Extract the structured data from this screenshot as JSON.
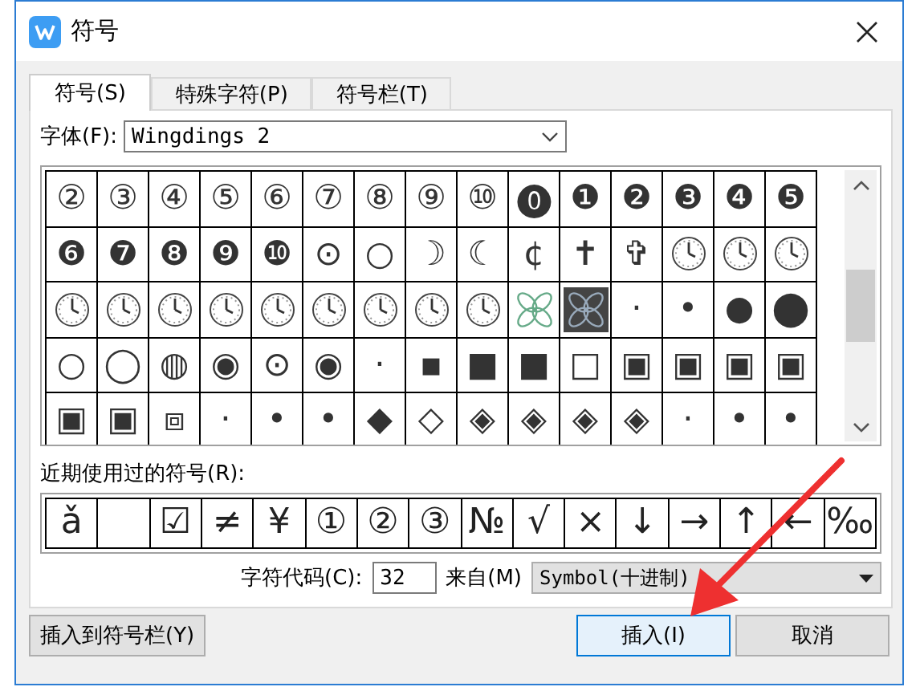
{
  "window": {
    "title": "符号"
  },
  "tabs": [
    {
      "label": "符号(S)",
      "selected": true
    },
    {
      "label": "特殊字符(P)",
      "selected": false
    },
    {
      "label": "符号栏(T)",
      "selected": false
    }
  ],
  "font": {
    "label": "字体(F):",
    "value": "Wingdings 2"
  },
  "symbol_grid": [
    [
      {
        "kind": "glyph",
        "symbol": "②"
      },
      {
        "kind": "glyph",
        "symbol": "③"
      },
      {
        "kind": "glyph",
        "symbol": "④"
      },
      {
        "kind": "glyph",
        "symbol": "⑤"
      },
      {
        "kind": "glyph",
        "symbol": "⑥"
      },
      {
        "kind": "glyph",
        "symbol": "⑦"
      },
      {
        "kind": "glyph",
        "symbol": "⑧"
      },
      {
        "kind": "glyph",
        "symbol": "⑨"
      },
      {
        "kind": "glyph",
        "symbol": "⑩"
      },
      {
        "kind": "glyph",
        "symbol": "⓿"
      },
      {
        "kind": "glyph",
        "symbol": "❶"
      },
      {
        "kind": "glyph",
        "symbol": "❷"
      },
      {
        "kind": "glyph",
        "symbol": "❸"
      },
      {
        "kind": "glyph",
        "symbol": "❹"
      },
      {
        "kind": "glyph",
        "symbol": "❺"
      }
    ],
    [
      {
        "kind": "glyph",
        "symbol": "❻"
      },
      {
        "kind": "glyph",
        "symbol": "❼"
      },
      {
        "kind": "glyph",
        "symbol": "❽"
      },
      {
        "kind": "glyph",
        "symbol": "❾"
      },
      {
        "kind": "glyph",
        "symbol": "❿"
      },
      {
        "kind": "glyph",
        "symbol": "⊙"
      },
      {
        "kind": "glyph",
        "symbol": "○"
      },
      {
        "kind": "glyph",
        "symbol": "☽"
      },
      {
        "kind": "glyph",
        "symbol": "☾"
      },
      {
        "kind": "glyph",
        "symbol": "¢"
      },
      {
        "kind": "glyph",
        "symbol": "✝"
      },
      {
        "kind": "glyph",
        "symbol": "✞"
      },
      {
        "kind": "clock"
      },
      {
        "kind": "clock"
      },
      {
        "kind": "clock"
      }
    ],
    [
      {
        "kind": "clock"
      },
      {
        "kind": "clock"
      },
      {
        "kind": "clock"
      },
      {
        "kind": "clock"
      },
      {
        "kind": "clock"
      },
      {
        "kind": "clock"
      },
      {
        "kind": "clock"
      },
      {
        "kind": "clock"
      },
      {
        "kind": "clock"
      },
      {
        "kind": "petals",
        "filled": false
      },
      {
        "kind": "petals",
        "filled": true
      },
      {
        "kind": "glyph",
        "symbol": "·"
      },
      {
        "kind": "glyph",
        "symbol": "•"
      },
      {
        "kind": "glyph",
        "symbol": "●"
      },
      {
        "kind": "glyph",
        "symbol": "⬤"
      }
    ],
    [
      {
        "kind": "glyph",
        "symbol": "○"
      },
      {
        "kind": "glyph",
        "symbol": "◯"
      },
      {
        "kind": "glyph",
        "symbol": "◍"
      },
      {
        "kind": "glyph",
        "symbol": "◉"
      },
      {
        "kind": "glyph",
        "symbol": "⊙"
      },
      {
        "kind": "glyph",
        "symbol": "◉"
      },
      {
        "kind": "glyph",
        "symbol": "·"
      },
      {
        "kind": "glyph",
        "symbol": "▪"
      },
      {
        "kind": "glyph",
        "symbol": "■"
      },
      {
        "kind": "glyph",
        "symbol": "■"
      },
      {
        "kind": "glyph",
        "symbol": "□"
      },
      {
        "kind": "glyph",
        "symbol": "▣"
      },
      {
        "kind": "glyph",
        "symbol": "▣"
      },
      {
        "kind": "glyph",
        "symbol": "▣"
      },
      {
        "kind": "glyph",
        "symbol": "▣"
      }
    ],
    [
      {
        "kind": "glyph",
        "symbol": "▣"
      },
      {
        "kind": "glyph",
        "symbol": "▣"
      },
      {
        "kind": "glyph",
        "symbol": "⧈"
      },
      {
        "kind": "glyph",
        "symbol": "·"
      },
      {
        "kind": "glyph",
        "symbol": "•"
      },
      {
        "kind": "glyph",
        "symbol": "•"
      },
      {
        "kind": "glyph",
        "symbol": "◆"
      },
      {
        "kind": "glyph",
        "symbol": "◇"
      },
      {
        "kind": "glyph",
        "symbol": "◈"
      },
      {
        "kind": "glyph",
        "symbol": "◈"
      },
      {
        "kind": "glyph",
        "symbol": "◈"
      },
      {
        "kind": "glyph",
        "symbol": "◈"
      },
      {
        "kind": "glyph",
        "symbol": "·"
      },
      {
        "kind": "glyph",
        "symbol": "•"
      },
      {
        "kind": "glyph",
        "symbol": "•"
      }
    ]
  ],
  "recent": {
    "label": "近期使用过的符号(R):",
    "symbols": [
      {
        "kind": "char",
        "symbol": "ǎ"
      },
      {
        "kind": "space"
      },
      {
        "kind": "char",
        "symbol": "☑"
      },
      {
        "kind": "char",
        "symbol": "≠"
      },
      {
        "kind": "char",
        "symbol": "¥"
      },
      {
        "kind": "char",
        "symbol": "①"
      },
      {
        "kind": "char",
        "symbol": "②"
      },
      {
        "kind": "char",
        "symbol": "③"
      },
      {
        "kind": "char",
        "symbol": "№"
      },
      {
        "kind": "char",
        "symbol": "√"
      },
      {
        "kind": "char",
        "symbol": "×"
      },
      {
        "kind": "char",
        "symbol": "↓"
      },
      {
        "kind": "char",
        "symbol": "→"
      },
      {
        "kind": "char",
        "symbol": "↑"
      },
      {
        "kind": "char",
        "symbol": "←"
      },
      {
        "kind": "char",
        "symbol": "‰"
      }
    ]
  },
  "char_code": {
    "label": "字符代码(C):",
    "value": "32",
    "from_label": "来自(M)",
    "from_value": "Symbol(十进制)"
  },
  "buttons": [
    {
      "label": "插入到符号栏(Y)",
      "kind": "left"
    },
    {
      "label": "插入(I)",
      "kind": "default"
    },
    {
      "label": "取消",
      "kind": "normal"
    }
  ]
}
